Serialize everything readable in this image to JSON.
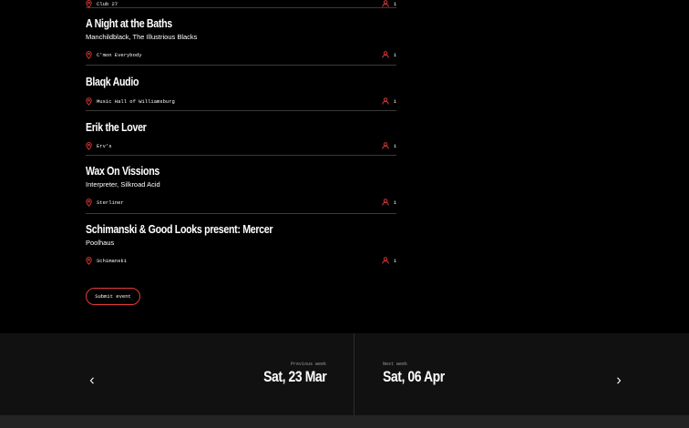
{
  "colors": {
    "accent": "#e53a3a",
    "background": "#000000",
    "nav_background": "#111111"
  },
  "events": [
    {
      "title": "",
      "lineup": "",
      "venue": "Club 27",
      "attendees": "1",
      "icon_venue": "map-pin-icon",
      "icon_att": "person-icon"
    },
    {
      "title": "A Night at the Baths",
      "lineup": "Manchildblack, The Illustrious Blacks",
      "venue": "C'mon Everybody",
      "attendees": "1"
    },
    {
      "title": "Blaqk Audio",
      "lineup": "",
      "venue": "Music Hall of Williamsburg",
      "attendees": "1"
    },
    {
      "title": "Erik the Lover",
      "lineup": "",
      "venue": "Erv's",
      "attendees": "1"
    },
    {
      "title": "Wax On Vissions",
      "lineup": "Interpreter, Silkroad Acid",
      "venue": "Sterliner",
      "attendees": "1"
    },
    {
      "title": "Schimanski & Good Looks present: Mercer",
      "lineup": "Poolhaus",
      "venue": "Schimanski",
      "attendees": "1"
    }
  ],
  "submit_label": "Submit event",
  "week_nav": {
    "prev_label": "Previous week",
    "prev_date": "Sat, 23 Mar",
    "next_label": "Next week",
    "next_date": "Sat, 06 Apr"
  }
}
